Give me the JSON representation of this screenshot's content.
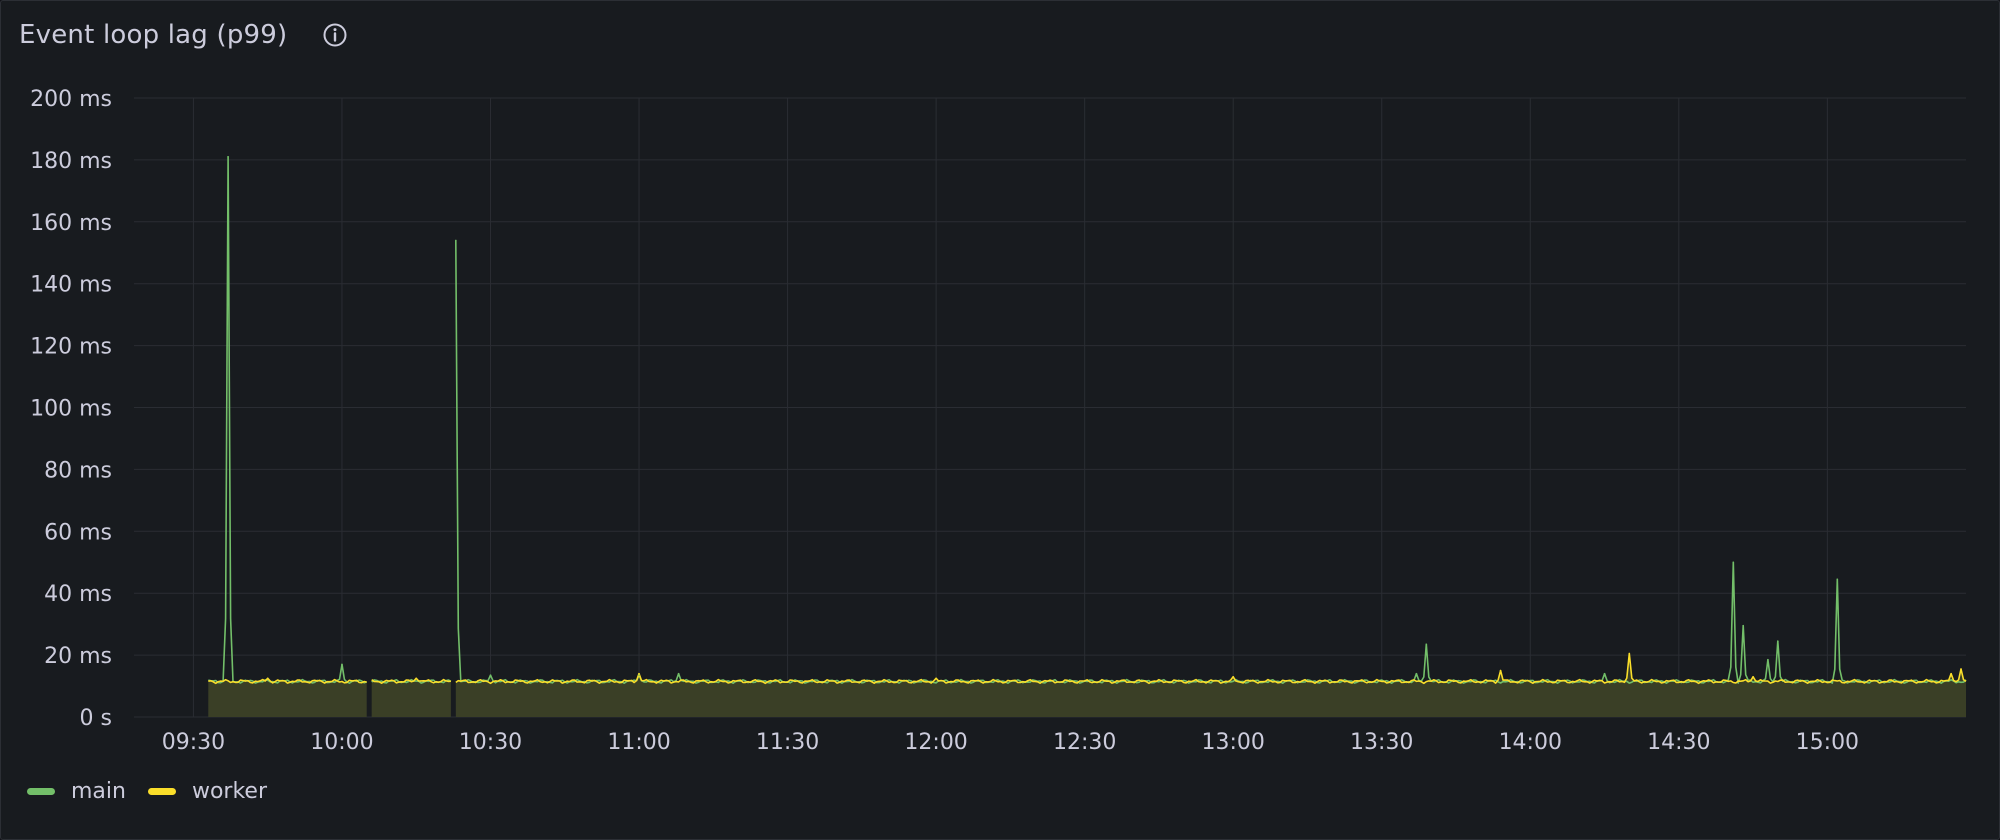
{
  "panel": {
    "title": "Event loop lag (p99)",
    "info_icon": "info-circle-icon"
  },
  "colors": {
    "main": "#73bf69",
    "worker": "#fade2a",
    "fill": "#3a3f26",
    "grid": "#2a2d33",
    "text": "#ccccdc"
  },
  "legend": {
    "items": [
      {
        "label": "main",
        "color": "#73bf69"
      },
      {
        "label": "worker",
        "color": "#fade2a"
      }
    ]
  },
  "chart_data": {
    "type": "line",
    "title": "Event loop lag (p99)",
    "x_start": "09:33",
    "x_end": "15:28",
    "xlim": [
      "09:18",
      "15:28"
    ],
    "ylim": [
      0,
      200
    ],
    "y_unit": "ms",
    "x_ticks": [
      "09:30",
      "10:00",
      "10:30",
      "11:00",
      "11:30",
      "12:00",
      "12:30",
      "13:00",
      "13:30",
      "14:00",
      "14:30",
      "15:00"
    ],
    "y_ticks": [
      "0 s",
      "20 ms",
      "40 ms",
      "60 ms",
      "80 ms",
      "100 ms",
      "120 ms",
      "140 ms",
      "160 ms",
      "180 ms",
      "200 ms"
    ],
    "grid": true,
    "legend_position": "bottom-left",
    "gaps": [
      [
        "10:05",
        "10:06"
      ],
      [
        "10:22",
        "10:23"
      ]
    ],
    "series": [
      {
        "name": "main",
        "baseline": 11.5,
        "spikes": [
          [
            "09:37",
            181
          ],
          [
            "10:00",
            17
          ],
          [
            "10:23",
            154
          ],
          [
            "10:30",
            13.5
          ],
          [
            "11:00",
            13.5
          ],
          [
            "11:08",
            14
          ],
          [
            "13:37",
            14
          ],
          [
            "13:39",
            23.5
          ],
          [
            "14:15",
            14
          ],
          [
            "14:41",
            50
          ],
          [
            "14:43",
            29.5
          ],
          [
            "14:48",
            18.5
          ],
          [
            "14:50",
            24.5
          ],
          [
            "15:02",
            44.5
          ]
        ]
      },
      {
        "name": "worker",
        "baseline": 11.5,
        "spikes": [
          [
            "09:45",
            12.5
          ],
          [
            "10:15",
            12.5
          ],
          [
            "11:00",
            14
          ],
          [
            "12:00",
            12.5
          ],
          [
            "13:00",
            13
          ],
          [
            "13:54",
            15
          ],
          [
            "14:20",
            20.5
          ],
          [
            "14:45",
            13
          ],
          [
            "15:25",
            14
          ],
          [
            "15:27",
            15.5
          ]
        ]
      }
    ]
  }
}
